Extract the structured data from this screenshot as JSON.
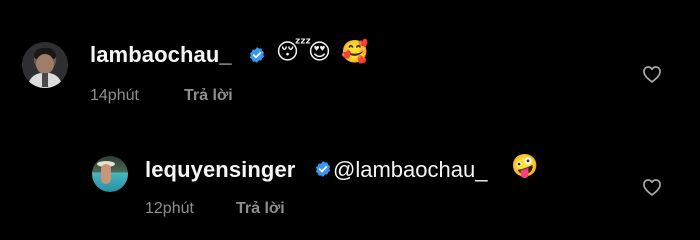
{
  "comments": [
    {
      "username": "lambaochau_",
      "verified": true,
      "emojis": [
        "😴",
        "😍",
        "🥰"
      ],
      "time": "14phút",
      "reply_label": "Trả lời",
      "like_icon": "heart-outline-icon"
    }
  ],
  "replies": [
    {
      "username": "lequyensinger",
      "verified": true,
      "mention": "@lambaochau_",
      "emojis": [
        "🤪"
      ],
      "time": "12phút",
      "reply_label": "Trả lời",
      "like_icon": "heart-outline-icon"
    }
  ],
  "colors": {
    "background": "#000000",
    "text_primary": "#f5f5f5",
    "text_secondary": "#8e8e8e",
    "verified_badge": "#3897f0"
  }
}
